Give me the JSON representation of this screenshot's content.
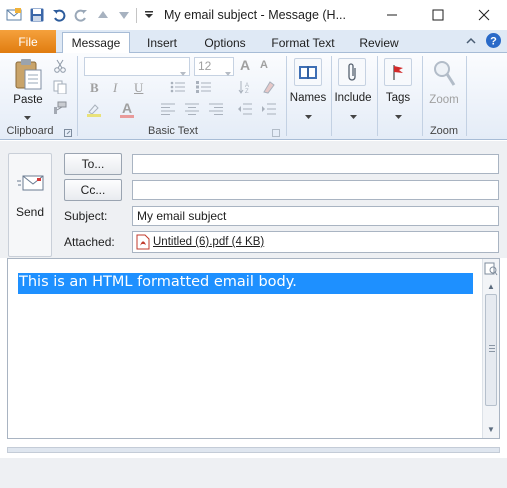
{
  "window": {
    "title": "My email subject  -  Message (H...",
    "minimize_glyph": "—",
    "maximize_glyph": "☐",
    "close_glyph": "✕"
  },
  "quick_access": {
    "icons": [
      "app-icon",
      "save-icon",
      "undo-icon",
      "redo-icon",
      "up-arrow-icon",
      "down-arrow-icon",
      "customize-icon"
    ]
  },
  "tabs": {
    "file": "File",
    "items": [
      "Message",
      "Insert",
      "Options",
      "Format Text",
      "Review"
    ],
    "active": "Message"
  },
  "ribbon": {
    "clipboard": {
      "label": "Clipboard",
      "paste": "Paste"
    },
    "basic_text": {
      "label": "Basic Text",
      "font_size": "12",
      "bold": "B",
      "italic": "I",
      "underline": "U",
      "font_color": "A",
      "grow": "A",
      "shrink": "A"
    },
    "names": {
      "label": "Names"
    },
    "include": {
      "label": "Include"
    },
    "tags": {
      "label": "Tags"
    },
    "zoom": {
      "button": "Zoom",
      "label": "Zoom"
    }
  },
  "compose": {
    "send": "Send",
    "to_button": "To...",
    "cc_button": "Cc...",
    "to_value": "",
    "cc_value": "",
    "subject_label": "Subject:",
    "subject_value": "My email subject",
    "attached_label": "Attached:",
    "attachment": "Untitled (6).pdf (4 KB)"
  },
  "body": {
    "text": "This is an HTML formatted email body."
  },
  "colors": {
    "file_tab": "#e8861a",
    "selection": "#1e90ff",
    "ribbon_border": "#a7bcd6"
  }
}
